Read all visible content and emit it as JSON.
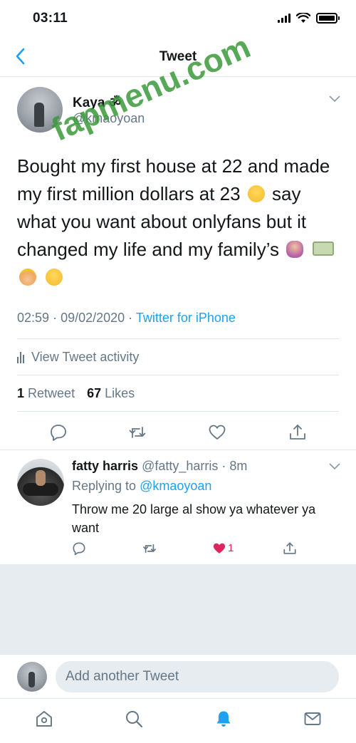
{
  "status_bar": {
    "time": "03:11"
  },
  "nav": {
    "title": "Tweet"
  },
  "watermark": {
    "text": "fapmenu.com"
  },
  "tweet": {
    "author_name": "Kaya ॐ",
    "author_handle": "@kmaoyoan",
    "text_part1": "Bought my first house at 22 and made my first million dollars at 23",
    "text_part2": "say what you want about onlyfans but it changed my life and my family’s",
    "time": "02:59",
    "date": "09/02/2020",
    "source": "Twitter for iPhone",
    "activity_label": "View Tweet activity",
    "retweets": "1",
    "retweets_label": "Retweet",
    "likes": "67",
    "likes_label": "Likes",
    "emojis": [
      "smiling-face-icon",
      "person-tipping-hand-icon",
      "money-icon",
      "princess-icon",
      "smiling-face-icon"
    ]
  },
  "reply": {
    "name": "fatty harris",
    "handle": "@fatty_harris",
    "age": "8m",
    "replying_prefix": "Replying to",
    "replying_to": "@kmaoyoan",
    "text": "Throw me 20 large al show ya whatever ya want",
    "like_count": "1"
  },
  "composer": {
    "placeholder": "Add another Tweet"
  },
  "colors": {
    "accent": "#1da1f2",
    "secondary_text": "#657786",
    "like_active": "#e0245e",
    "divider": "#e1e8ed",
    "background_gray": "#e6ecf0"
  }
}
